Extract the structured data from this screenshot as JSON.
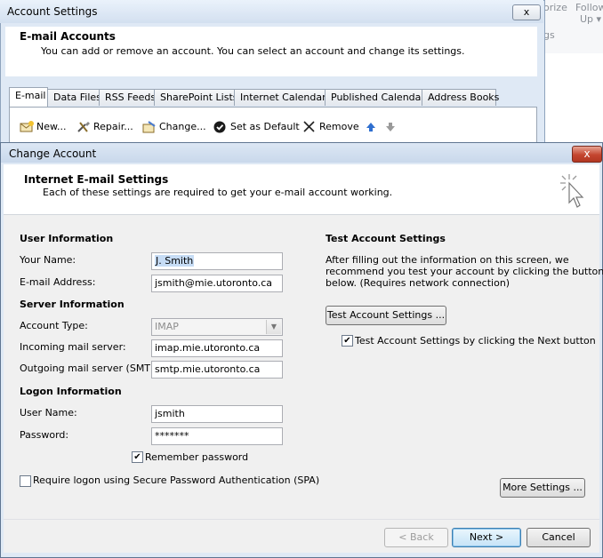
{
  "background_ribbon": {
    "item1": "orize",
    "item2": "Follow",
    "item3": "Up ▾",
    "item4": "gs"
  },
  "account_settings": {
    "title": "Account Settings",
    "close_label": "x",
    "header_title": "E-mail Accounts",
    "header_desc": "You can add or remove an account. You can select an account and change its settings.",
    "tabs": [
      {
        "label": "E-mail"
      },
      {
        "label": "Data Files"
      },
      {
        "label": "RSS Feeds"
      },
      {
        "label": "SharePoint Lists"
      },
      {
        "label": "Internet Calendars"
      },
      {
        "label": "Published Calendars"
      },
      {
        "label": "Address Books"
      }
    ],
    "toolbar": {
      "new_label": "New...",
      "repair_label": "Repair...",
      "change_label": "Change...",
      "set_default_label": "Set as Default",
      "remove_label": "Remove"
    }
  },
  "change_account": {
    "title": "Change Account",
    "close_label": "x",
    "header_title": "Internet E-mail Settings",
    "header_desc": "Each of these settings are required to get your e-mail account working.",
    "user_info": {
      "section": "User Information",
      "name_label": "Your Name:",
      "name_value": "J. Smith",
      "email_label": "E-mail Address:",
      "email_value": "jsmith@mie.utoronto.ca"
    },
    "server_info": {
      "section": "Server Information",
      "type_label": "Account Type:",
      "type_value": "IMAP",
      "incoming_label": "Incoming mail server:",
      "incoming_value": "imap.mie.utoronto.ca",
      "outgoing_label": "Outgoing mail server (SMTP):",
      "outgoing_value": "smtp.mie.utoronto.ca"
    },
    "logon_info": {
      "section": "Logon Information",
      "user_label": "User Name:",
      "user_value": "jsmith",
      "password_label": "Password:",
      "password_value": "*******",
      "remember_label": "Remember password",
      "remember_checked": true,
      "spa_label": "Require logon using Secure Password Authentication (SPA)",
      "spa_checked": false
    },
    "test": {
      "section": "Test Account Settings",
      "desc_line1": "After filling out the information on this screen, we",
      "desc_line2": "recommend you test your account by clicking the button",
      "desc_line3": "below. (Requires network connection)",
      "test_button": "Test Account Settings ...",
      "auto_test_label": "Test Account Settings by clicking the Next button",
      "auto_test_checked": true
    },
    "more_settings_button": "More Settings ...",
    "back_button": "< Back",
    "next_button": "Next >",
    "cancel_button": "Cancel"
  },
  "colors": {
    "window_bg": "#dfe9f5",
    "dialog_bg": "#f0f0f0",
    "close_red": "#c4452f",
    "selection": "#c6dcf5"
  }
}
